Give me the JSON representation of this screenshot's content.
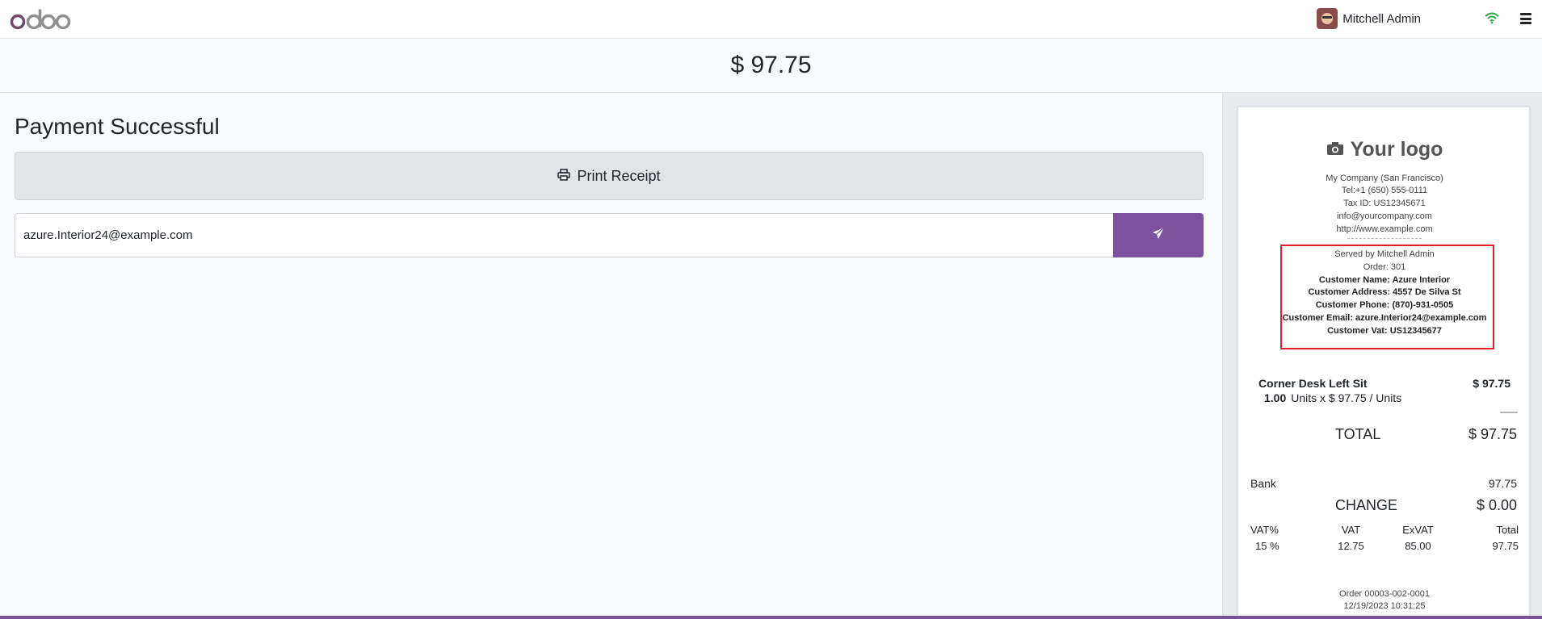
{
  "navbar": {
    "logo_text": "odoo",
    "user_name": "Mitchell Admin",
    "wifi_icon": "wifi-icon",
    "menu_icon": "hamburger-menu-icon"
  },
  "header": {
    "amount": "$ 97.75"
  },
  "main": {
    "title": "Payment Successful",
    "print_label": "Print Receipt",
    "email_value": "azure.Interior24@example.com",
    "send_icon": "paper-plane-icon"
  },
  "receipt": {
    "logo_text": "Your logo",
    "company": {
      "name": "My Company (San Francisco)",
      "tel": "Tel:+1 (650) 555-0111",
      "tax_id": "Tax ID: US12345671",
      "email": "info@yourcompany.com",
      "website": "http://www.example.com"
    },
    "served_by": "Served by Mitchell Admin",
    "order_no": "Order: 301",
    "customer": {
      "name": "Customer Name: Azure Interior",
      "address": "Customer Address: 4557 De Silva St",
      "phone": "Customer Phone: (870)-931-0505",
      "email": "Customer Email: azure.Interior24@example.com",
      "vat": "Customer Vat: US12345677"
    },
    "line": {
      "product": "Corner Desk Left Sit",
      "price": "$ 97.75",
      "qty": "1.00",
      "unit_detail": "Units x $ 97.75 / Units"
    },
    "separator": "--------",
    "total_label": "TOTAL",
    "total_value": "$ 97.75",
    "payment_method": "Bank",
    "payment_amount": "97.75",
    "change_label": "CHANGE",
    "change_value": "$ 0.00",
    "tax_headers": [
      "VAT%",
      "VAT",
      "ExVAT",
      "Total"
    ],
    "tax_values": [
      "15 %",
      "12.75",
      "85.00",
      "97.75"
    ],
    "order_ref": "Order 00003-002-0001",
    "order_date": "12/19/2023 10:31:25"
  },
  "colors": {
    "brand": "#7c529e",
    "highlight": "#e0202a"
  }
}
